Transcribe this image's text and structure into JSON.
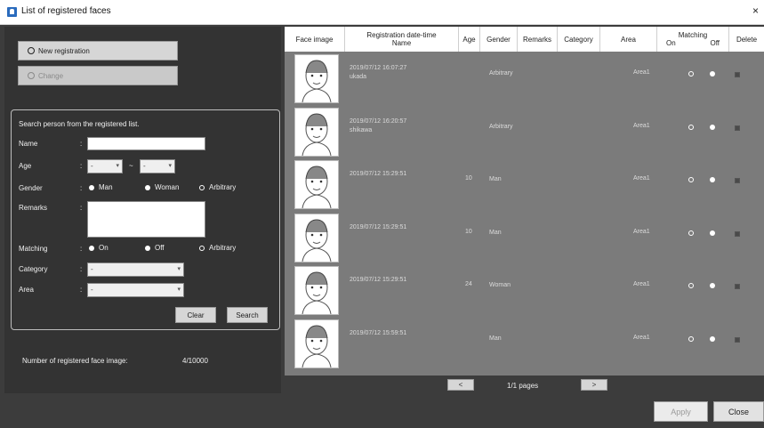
{
  "window": {
    "title": "List of registered faces"
  },
  "left": {
    "new_registration": "New registration",
    "change": "Change",
    "search_title": "Search person from the registered list.",
    "labels": {
      "name": "Name",
      "age": "Age",
      "gender": "Gender",
      "remarks": "Remarks",
      "matching": "Matching",
      "category": "Category",
      "area": "Area"
    },
    "colon": ":",
    "age_dash": "~",
    "age_from": "-",
    "age_to": "-",
    "gender_options": [
      "Man",
      "Woman",
      "Arbitrary"
    ],
    "matching_options": [
      "On",
      "Off",
      "Arbitrary"
    ],
    "category_value": "-",
    "area_value": "-",
    "clear": "Clear",
    "search": "Search",
    "count_label": "Number of registered face image:",
    "count_value": "4/10000"
  },
  "table": {
    "headers": {
      "face_image": "Face image",
      "registration": "Registration date-time",
      "name": "Name",
      "age": "Age",
      "gender": "Gender",
      "remarks": "Remarks",
      "category": "Category",
      "area": "Area",
      "matching": "Matching",
      "on": "On",
      "off": "Off",
      "delete": "Delete"
    },
    "rows": [
      {
        "datetime": "2019/07/12 16:07:27",
        "name": "ukada",
        "age": "",
        "gender": "Arbitrary",
        "area": "Area1"
      },
      {
        "datetime": "2019/07/12 16:20:57",
        "name": "shikawa",
        "age": "",
        "gender": "Arbitrary",
        "area": "Area1"
      },
      {
        "datetime": "2019/07/12 15:29:51",
        "name": "",
        "age": "10",
        "gender": "Man",
        "area": "Area1"
      },
      {
        "datetime": "2019/07/12 15:29:51",
        "name": "",
        "age": "10",
        "gender": "Man",
        "area": "Area1"
      },
      {
        "datetime": "2019/07/12 15:29:51",
        "name": "",
        "age": "24",
        "gender": "Woman",
        "area": "Area1"
      },
      {
        "datetime": "2019/07/12 15:59:51",
        "name": "",
        "age": "",
        "gender": "Man",
        "area": "Area1"
      }
    ]
  },
  "pager": {
    "prev": "<",
    "next": ">",
    "text": "1/1 pages"
  },
  "footer": {
    "apply": "Apply",
    "close": "Close"
  },
  "window_close": "×"
}
